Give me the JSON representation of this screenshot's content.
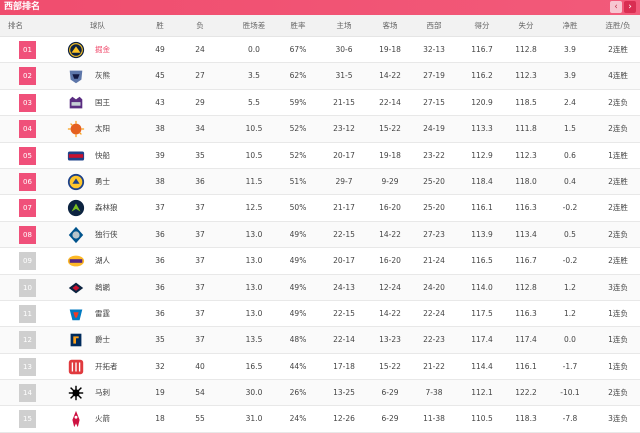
{
  "header": {
    "title": "西部排名",
    "prev": "‹",
    "next": "›"
  },
  "columns": [
    "排名",
    "球队",
    "胜",
    "负",
    "胜场差",
    "胜率",
    "主场",
    "客场",
    "西部",
    "得分",
    "失分",
    "净胜",
    "连胜/负"
  ],
  "rows": [
    {
      "rank": "01",
      "team": "掘金",
      "logo": "nuggets-logo",
      "w": "49",
      "l": "24",
      "gb": "0.0",
      "pct": "67%",
      "home": "30-6",
      "away": "19-18",
      "conf": "32-13",
      "pf": "116.7",
      "pa": "112.8",
      "diff": "3.9",
      "streak": "2连胜"
    },
    {
      "rank": "02",
      "team": "灰熊",
      "logo": "grizzlies-logo",
      "w": "45",
      "l": "27",
      "gb": "3.5",
      "pct": "62%",
      "home": "31-5",
      "away": "14-22",
      "conf": "27-19",
      "pf": "116.2",
      "pa": "112.3",
      "diff": "3.9",
      "streak": "4连胜"
    },
    {
      "rank": "03",
      "team": "国王",
      "logo": "kings-logo",
      "w": "43",
      "l": "29",
      "gb": "5.5",
      "pct": "59%",
      "home": "21-15",
      "away": "22-14",
      "conf": "27-15",
      "pf": "120.9",
      "pa": "118.5",
      "diff": "2.4",
      "streak": "2连负"
    },
    {
      "rank": "04",
      "team": "太阳",
      "logo": "suns-logo",
      "w": "38",
      "l": "34",
      "gb": "10.5",
      "pct": "52%",
      "home": "23-12",
      "away": "15-22",
      "conf": "24-19",
      "pf": "113.3",
      "pa": "111.8",
      "diff": "1.5",
      "streak": "2连负"
    },
    {
      "rank": "05",
      "team": "快船",
      "logo": "clippers-logo",
      "w": "39",
      "l": "35",
      "gb": "10.5",
      "pct": "52%",
      "home": "20-17",
      "away": "19-18",
      "conf": "23-22",
      "pf": "112.9",
      "pa": "112.3",
      "diff": "0.6",
      "streak": "1连胜"
    },
    {
      "rank": "06",
      "team": "勇士",
      "logo": "warriors-logo",
      "w": "38",
      "l": "36",
      "gb": "11.5",
      "pct": "51%",
      "home": "29-7",
      "away": "9-29",
      "conf": "25-20",
      "pf": "118.4",
      "pa": "118.0",
      "diff": "0.4",
      "streak": "2连胜"
    },
    {
      "rank": "07",
      "team": "森林狼",
      "logo": "timberwolves-logo",
      "w": "37",
      "l": "37",
      "gb": "12.5",
      "pct": "50%",
      "home": "21-17",
      "away": "16-20",
      "conf": "25-20",
      "pf": "116.1",
      "pa": "116.3",
      "diff": "-0.2",
      "streak": "2连胜"
    },
    {
      "rank": "08",
      "team": "独行侠",
      "logo": "mavericks-logo",
      "w": "36",
      "l": "37",
      "gb": "13.0",
      "pct": "49%",
      "home": "22-15",
      "away": "14-22",
      "conf": "27-23",
      "pf": "113.9",
      "pa": "113.4",
      "diff": "0.5",
      "streak": "2连负"
    },
    {
      "rank": "09",
      "team": "湖人",
      "logo": "lakers-logo",
      "w": "36",
      "l": "37",
      "gb": "13.0",
      "pct": "49%",
      "home": "20-17",
      "away": "16-20",
      "conf": "21-24",
      "pf": "116.5",
      "pa": "116.7",
      "diff": "-0.2",
      "streak": "2连胜"
    },
    {
      "rank": "10",
      "team": "鹈鹕",
      "logo": "pelicans-logo",
      "w": "36",
      "l": "37",
      "gb": "13.0",
      "pct": "49%",
      "home": "24-13",
      "away": "12-24",
      "conf": "24-20",
      "pf": "114.0",
      "pa": "112.8",
      "diff": "1.2",
      "streak": "3连负"
    },
    {
      "rank": "11",
      "team": "雷霆",
      "logo": "thunder-logo",
      "w": "36",
      "l": "37",
      "gb": "13.0",
      "pct": "49%",
      "home": "22-15",
      "away": "14-22",
      "conf": "22-24",
      "pf": "117.5",
      "pa": "116.3",
      "diff": "1.2",
      "streak": "1连负"
    },
    {
      "rank": "12",
      "team": "爵士",
      "logo": "jazz-logo",
      "w": "35",
      "l": "37",
      "gb": "13.5",
      "pct": "48%",
      "home": "22-14",
      "away": "13-23",
      "conf": "22-23",
      "pf": "117.4",
      "pa": "117.4",
      "diff": "0.0",
      "streak": "1连负"
    },
    {
      "rank": "13",
      "team": "开拓者",
      "logo": "blazers-logo",
      "w": "32",
      "l": "40",
      "gb": "16.5",
      "pct": "44%",
      "home": "17-18",
      "away": "15-22",
      "conf": "21-22",
      "pf": "114.4",
      "pa": "116.1",
      "diff": "-1.7",
      "streak": "1连负"
    },
    {
      "rank": "14",
      "team": "马刺",
      "logo": "spurs-logo",
      "w": "19",
      "l": "54",
      "gb": "30.0",
      "pct": "26%",
      "home": "13-25",
      "away": "6-29",
      "conf": "7-38",
      "pf": "112.1",
      "pa": "122.2",
      "diff": "-10.1",
      "streak": "2连负"
    },
    {
      "rank": "15",
      "team": "火箭",
      "logo": "rockets-logo",
      "w": "18",
      "l": "55",
      "gb": "31.0",
      "pct": "24%",
      "home": "12-26",
      "away": "6-29",
      "conf": "11-38",
      "pf": "110.5",
      "pa": "118.3",
      "diff": "-7.8",
      "streak": "3连负"
    }
  ],
  "colors": {
    "accent": "#f04d6e",
    "playoff_badge": "#f0507a",
    "other_badge": "#cfcfcf"
  }
}
